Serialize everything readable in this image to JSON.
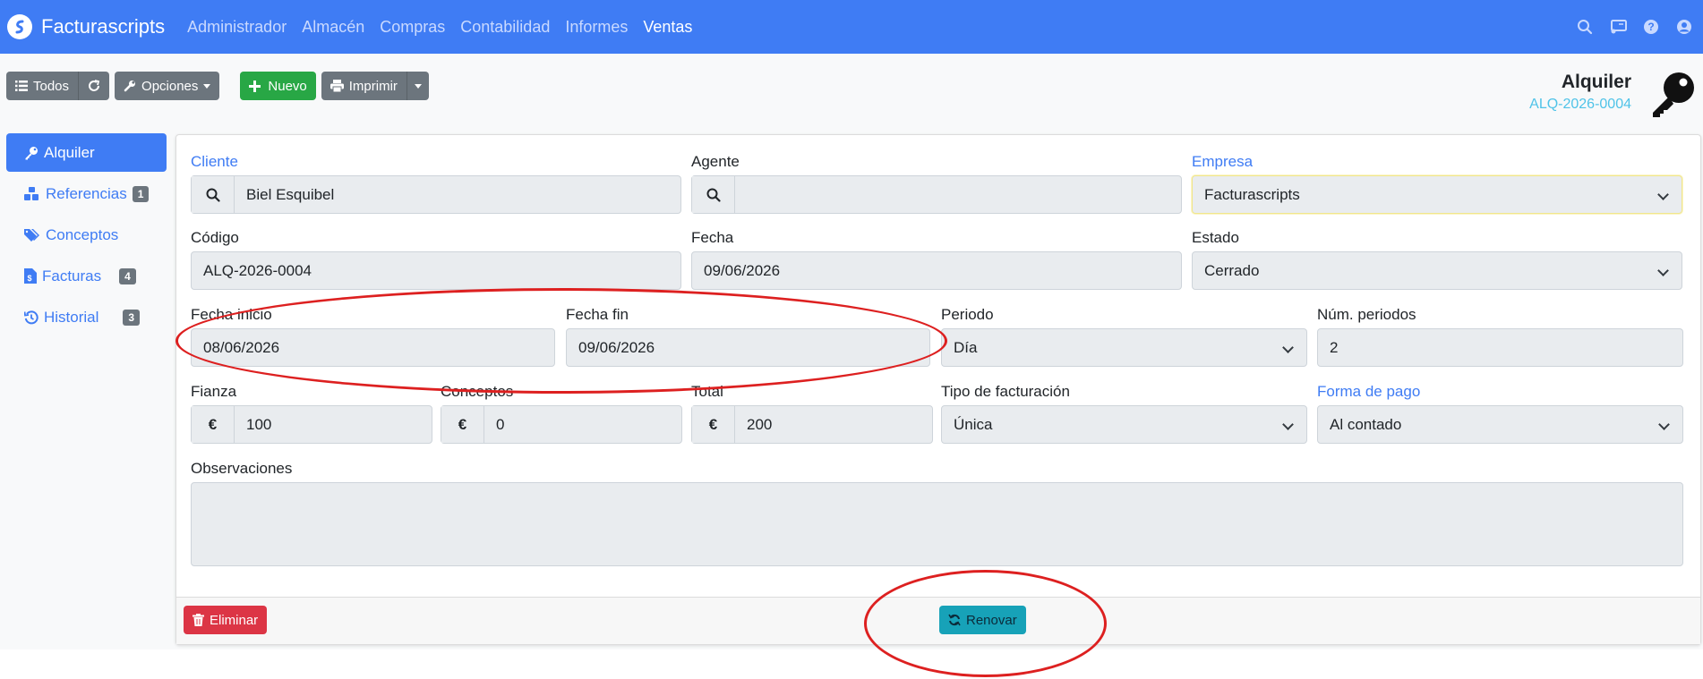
{
  "navbar": {
    "brand": "Facturascripts",
    "menu": [
      {
        "label": "Administrador",
        "active": false
      },
      {
        "label": "Almacén",
        "active": false
      },
      {
        "label": "Compras",
        "active": false
      },
      {
        "label": "Contabilidad",
        "active": false
      },
      {
        "label": "Informes",
        "active": false
      },
      {
        "label": "Ventas",
        "active": true
      }
    ],
    "icons": [
      "search-icon",
      "cast-icon",
      "help-icon",
      "user-icon"
    ]
  },
  "toolbar": {
    "all_label": "Todos",
    "options_label": "Opciones",
    "new_label": "Nuevo",
    "print_label": "Imprimir"
  },
  "header": {
    "title": "Alquiler",
    "code": "ALQ-2026-0004",
    "icon": "key-icon"
  },
  "sidebar": {
    "items": [
      {
        "label": "Alquiler",
        "icon": "key-icon",
        "badge": null,
        "active": true
      },
      {
        "label": "Referencias",
        "icon": "cubes-icon",
        "badge": "1",
        "active": false
      },
      {
        "label": "Conceptos",
        "icon": "tags-icon",
        "badge": null,
        "active": false
      },
      {
        "label": "Facturas",
        "icon": "invoice-icon",
        "badge": "4",
        "active": false
      },
      {
        "label": "Historial",
        "icon": "history-icon",
        "badge": "3",
        "active": false
      }
    ]
  },
  "form": {
    "cliente": {
      "label": "Cliente",
      "value": "Biel Esquibel"
    },
    "agente": {
      "label": "Agente",
      "value": ""
    },
    "empresa": {
      "label": "Empresa",
      "value": "Facturascripts"
    },
    "codigo": {
      "label": "Código",
      "value": "ALQ-2026-0004"
    },
    "fecha": {
      "label": "Fecha",
      "value": "09/06/2026"
    },
    "estado": {
      "label": "Estado",
      "value": "Cerrado"
    },
    "fecha_inicio": {
      "label": "Fecha inicio",
      "value": "08/06/2026"
    },
    "fecha_fin": {
      "label": "Fecha fin",
      "value": "09/06/2026"
    },
    "periodo": {
      "label": "Periodo",
      "value": "Día"
    },
    "num_periodos": {
      "label": "Núm. periodos",
      "value": "2"
    },
    "fianza": {
      "label": "Fianza",
      "value": "100",
      "currency": "€"
    },
    "conceptos": {
      "label": "Conceptos",
      "value": "0",
      "currency": "€"
    },
    "total": {
      "label": "Total",
      "value": "200",
      "currency": "€"
    },
    "tipo_facturacion": {
      "label": "Tipo de facturación",
      "value": "Única"
    },
    "forma_pago": {
      "label": "Forma de pago",
      "value": "Al contado"
    },
    "observaciones": {
      "label": "Observaciones",
      "value": ""
    }
  },
  "footer": {
    "delete_label": "Eliminar",
    "renew_label": "Renovar"
  },
  "colors": {
    "primary": "#3f7cf4",
    "success": "#28a745",
    "danger": "#dc3545",
    "info": "#17a2b8",
    "secondary": "#6c757d",
    "annotation": "#dd2020"
  }
}
